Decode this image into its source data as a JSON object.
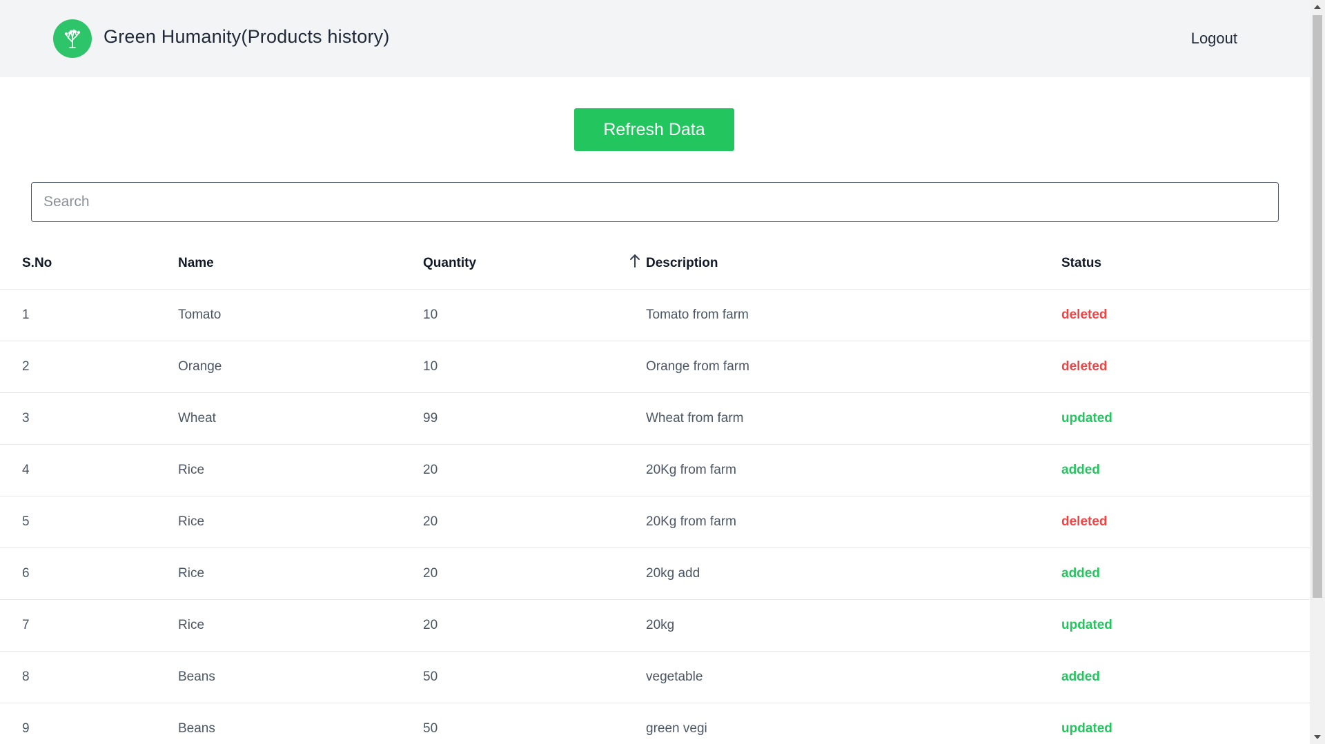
{
  "header": {
    "title": "Green Humanity(Products history)",
    "logout_label": "Logout",
    "logo_icon": "tree-icon",
    "logo_color": "#2ec46a"
  },
  "actions": {
    "refresh_label": "Refresh Data",
    "refresh_color": "#22c55e"
  },
  "search": {
    "placeholder": "Search",
    "value": ""
  },
  "table": {
    "columns": [
      "S.No",
      "Name",
      "Quantity",
      "Description",
      "Status"
    ],
    "sort": {
      "column": "Description",
      "direction": "ascending",
      "icon": "arrow-up-icon"
    },
    "rows": [
      {
        "sno": "1",
        "name": "Tomato",
        "quantity": "10",
        "description": "Tomato from farm",
        "status": "deleted"
      },
      {
        "sno": "2",
        "name": "Orange",
        "quantity": "10",
        "description": "Orange from farm",
        "status": "deleted"
      },
      {
        "sno": "3",
        "name": "Wheat",
        "quantity": "99",
        "description": "Wheat from farm",
        "status": "updated"
      },
      {
        "sno": "4",
        "name": "Rice",
        "quantity": "20",
        "description": "20Kg from farm",
        "status": "added"
      },
      {
        "sno": "5",
        "name": "Rice",
        "quantity": "20",
        "description": "20Kg from farm",
        "status": "deleted"
      },
      {
        "sno": "6",
        "name": "Rice",
        "quantity": "20",
        "description": "20kg add",
        "status": "added"
      },
      {
        "sno": "7",
        "name": "Rice",
        "quantity": "20",
        "description": "20kg",
        "status": "updated"
      },
      {
        "sno": "8",
        "name": "Beans",
        "quantity": "50",
        "description": "vegetable",
        "status": "added"
      },
      {
        "sno": "9",
        "name": "Beans",
        "quantity": "50",
        "description": "green vegi",
        "status": "updated"
      }
    ]
  },
  "status_colors": {
    "deleted": "#ef4444",
    "updated": "#22c55e",
    "added": "#22c55e"
  }
}
